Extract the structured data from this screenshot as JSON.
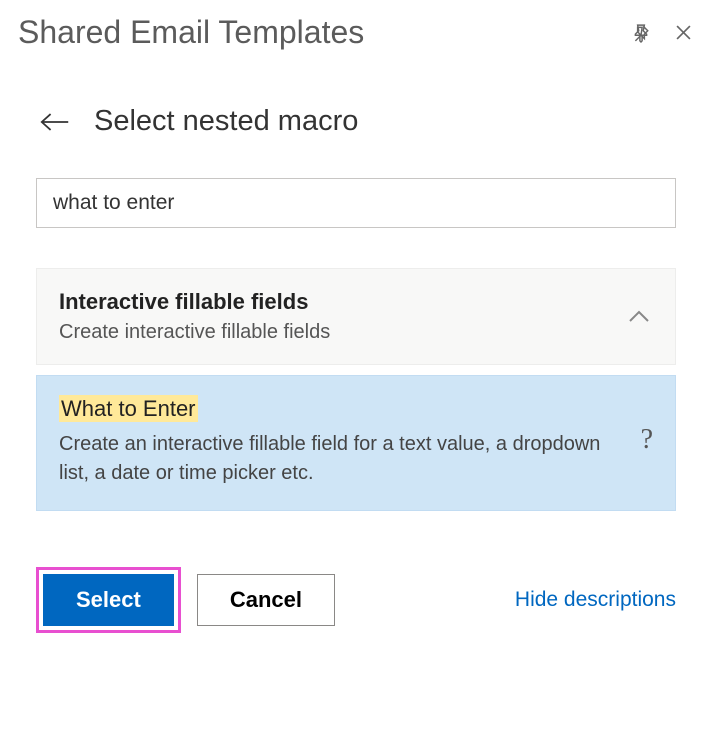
{
  "header": {
    "title": "Shared Email Templates"
  },
  "subheader": {
    "title": "Select nested macro"
  },
  "search": {
    "value": "what to enter",
    "placeholder": ""
  },
  "category": {
    "title": "Interactive fillable fields",
    "description": "Create interactive fillable fields"
  },
  "macro": {
    "title": "What to Enter",
    "description": "Create an interactive fillable field for a text value, a dropdown list, a date or time picker etc."
  },
  "footer": {
    "select_label": "Select",
    "cancel_label": "Cancel",
    "hide_descriptions_label": "Hide descriptions"
  }
}
